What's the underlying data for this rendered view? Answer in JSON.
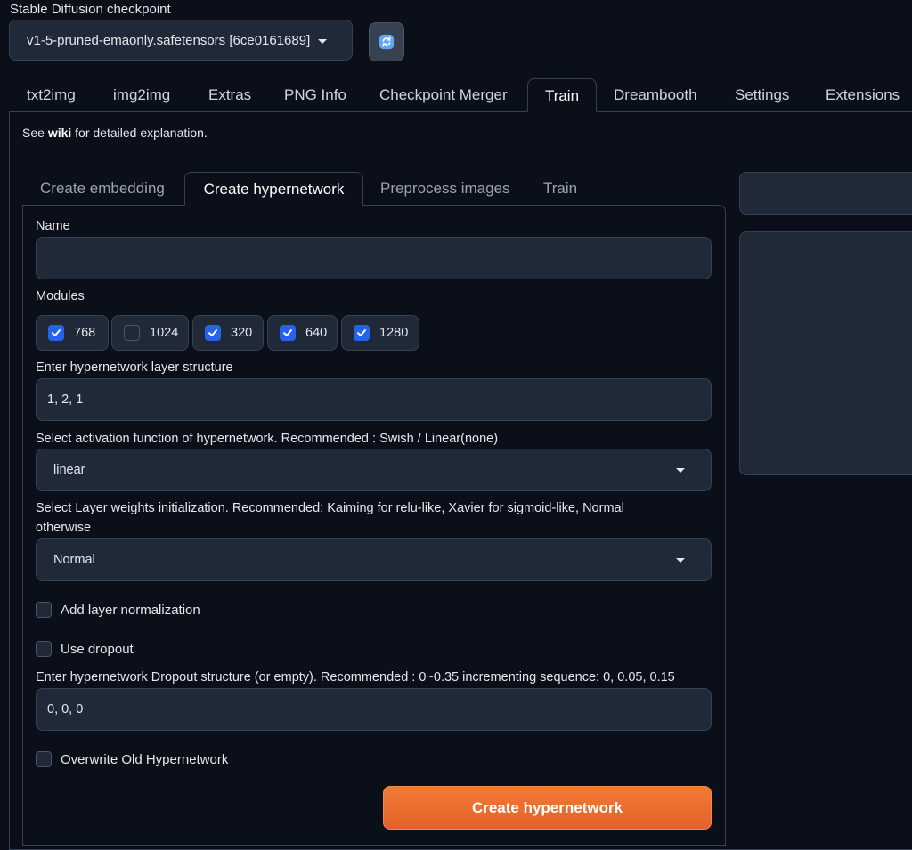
{
  "checkpoint": {
    "label": "Stable Diffusion checkpoint",
    "selected": "v1-5-pruned-emaonly.safetensors [6ce0161689]",
    "refresh_icon": "refresh-icon"
  },
  "main_tabs": [
    "txt2img",
    "img2img",
    "Extras",
    "PNG Info",
    "Checkpoint Merger",
    "Train",
    "Dreambooth",
    "Settings",
    "Extensions"
  ],
  "main_tab_active": "Train",
  "wiki": {
    "prefix": "See ",
    "link": "wiki",
    "suffix": " for detailed explanation."
  },
  "sub_tabs": [
    "Create embedding",
    "Create hypernetwork",
    "Preprocess images",
    "Train"
  ],
  "sub_tab_active": "Create hypernetwork",
  "form": {
    "name_label": "Name",
    "name_value": "",
    "modules_label": "Modules",
    "modules": [
      {
        "label": "768",
        "checked": true
      },
      {
        "label": "1024",
        "checked": false
      },
      {
        "label": "320",
        "checked": true
      },
      {
        "label": "640",
        "checked": true
      },
      {
        "label": "1280",
        "checked": true
      }
    ],
    "layer_structure_label": "Enter hypernetwork layer structure",
    "layer_structure_value": "1, 2, 1",
    "activation_label": "Select activation function of hypernetwork. Recommended : Swish / Linear(none)",
    "activation_value": "linear",
    "init_label_line1": "Select Layer weights initialization. Recommended: Kaiming for relu-like, Xavier for sigmoid-like, Normal",
    "init_label_line2": "otherwise",
    "init_value": "Normal",
    "layer_norm_label": "Add layer normalization",
    "layer_norm_checked": false,
    "dropout_label": "Use dropout",
    "dropout_checked": false,
    "dropout_structure_label": "Enter hypernetwork Dropout structure (or empty). Recommended : 0~0.35 incrementing sequence: 0, 0.05, 0.15",
    "dropout_structure_value": "0, 0, 0",
    "overwrite_label": "Overwrite Old Hypernetwork",
    "overwrite_checked": false,
    "create_button": "Create hypernetwork"
  },
  "colors": {
    "background": "#0b0f19",
    "panel": "#1f2937",
    "border": "#374151",
    "checkbox_on": "#2563eb",
    "primary_button": "#e9692c"
  }
}
